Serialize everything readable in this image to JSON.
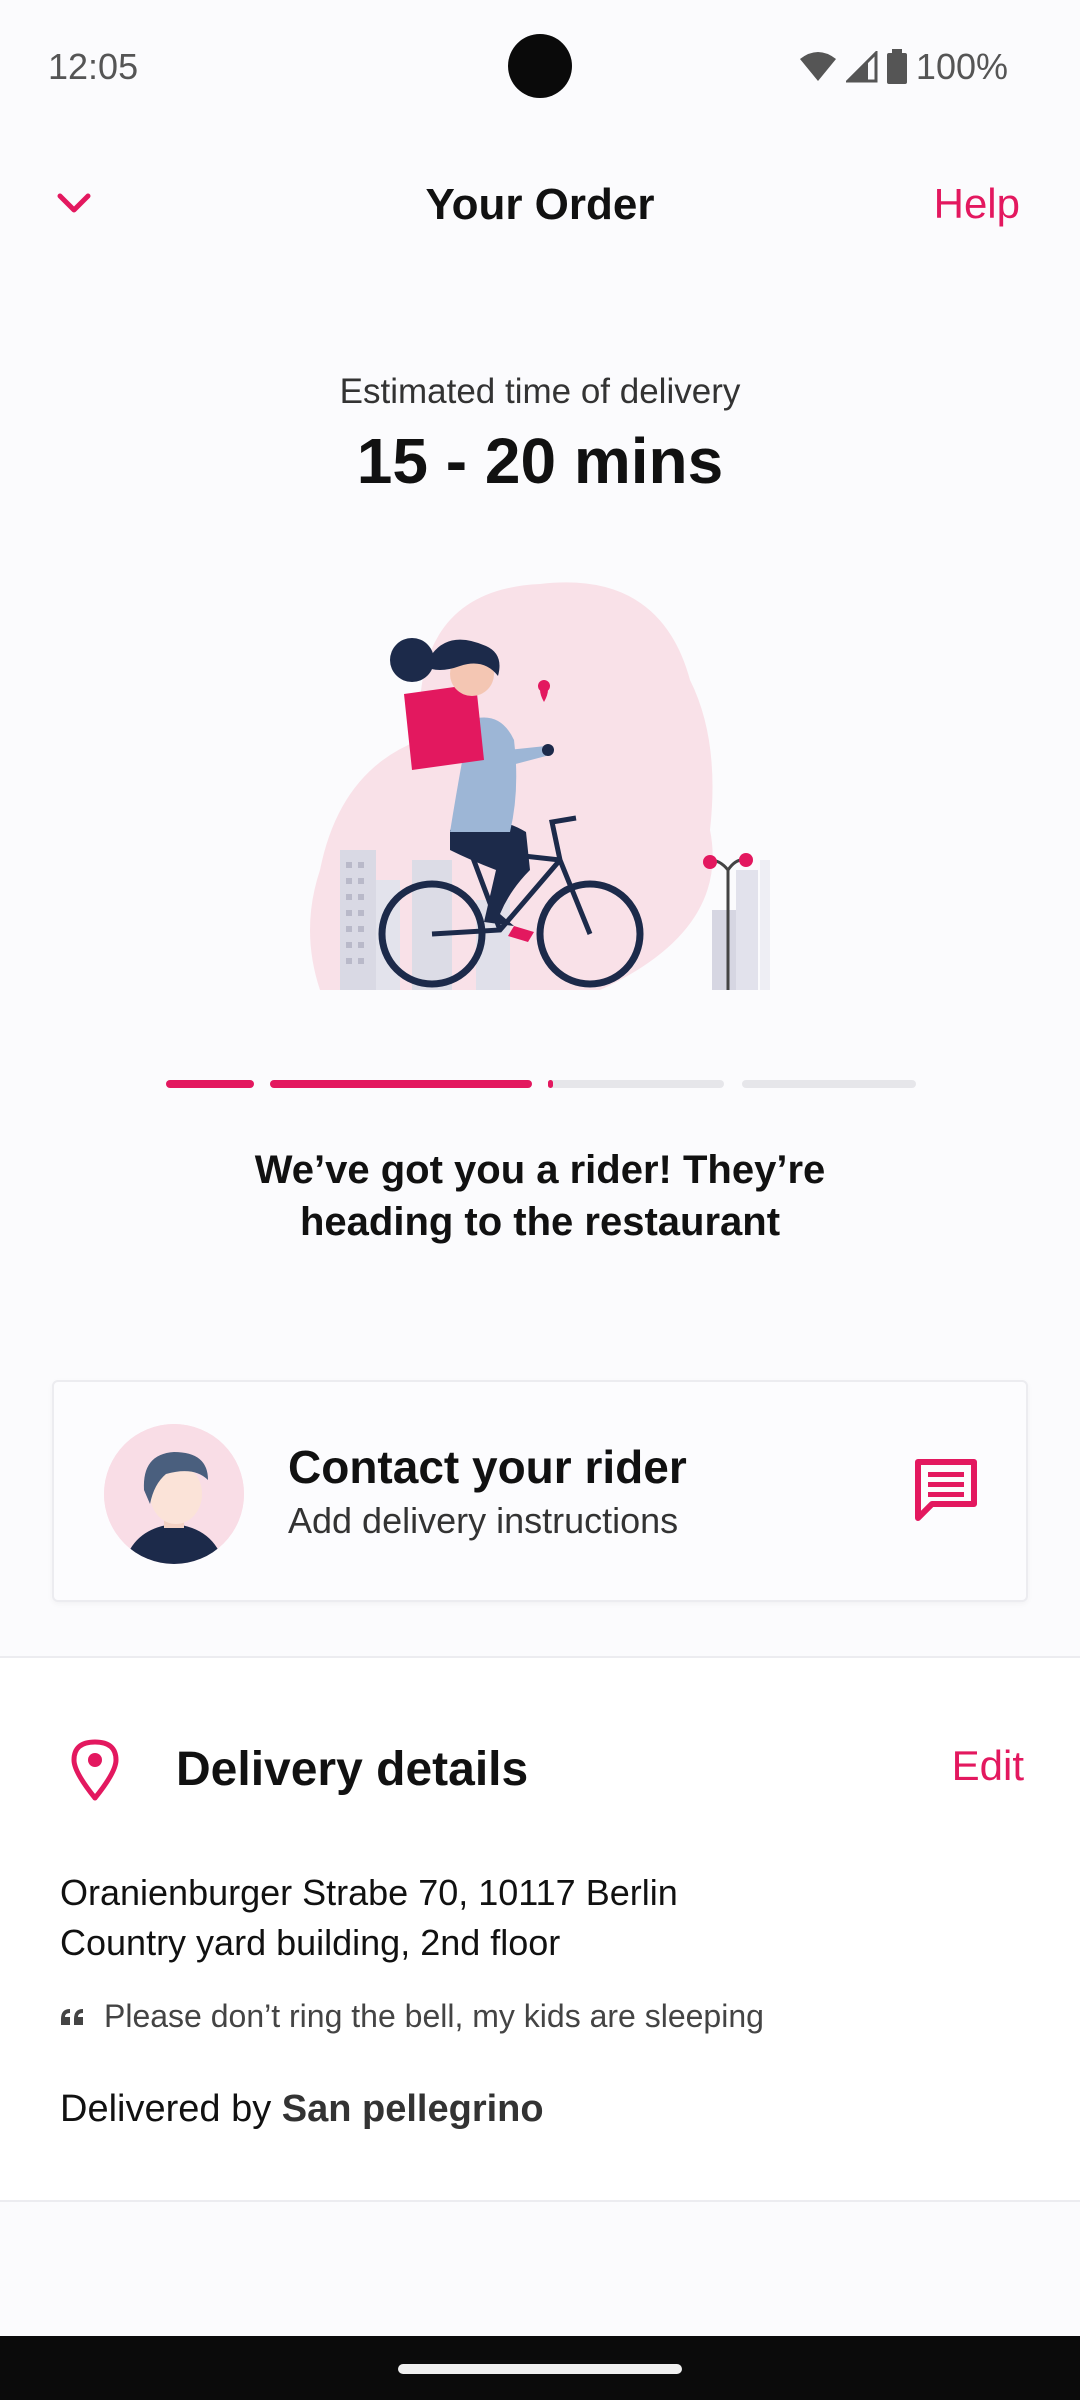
{
  "status_bar": {
    "time": "12:05",
    "battery": "100%"
  },
  "header": {
    "title": "Your Order",
    "help_label": "Help"
  },
  "eta": {
    "label": "Estimated time of delivery",
    "value": "15 - 20 mins"
  },
  "progress": {
    "steps_total": 4,
    "steps_done": 2,
    "current_step_fraction": 0.03
  },
  "status_message": {
    "line1": "We’ve got you a rider! They’re",
    "line2": "heading to the restaurant"
  },
  "rider_card": {
    "title": "Contact your rider",
    "subtitle": "Add delivery instructions"
  },
  "delivery_details": {
    "title": "Delivery details",
    "edit_label": "Edit",
    "address_line1": "Oranienburger Strabe 70, 10117 Berlin",
    "address_line2": "Country yard building, 2nd floor",
    "note": "Please don’t ring the bell, my kids are sleeping",
    "delivered_by_prefix": "Delivered by",
    "delivered_by_name": "San pellegrino"
  },
  "colors": {
    "accent": "#e3185f",
    "track": "#e6e6ea"
  },
  "icons": [
    "chevron-down-icon",
    "wifi-icon",
    "signal-icon",
    "battery-icon",
    "chat-icon",
    "location-pin-icon",
    "quote-icon"
  ]
}
